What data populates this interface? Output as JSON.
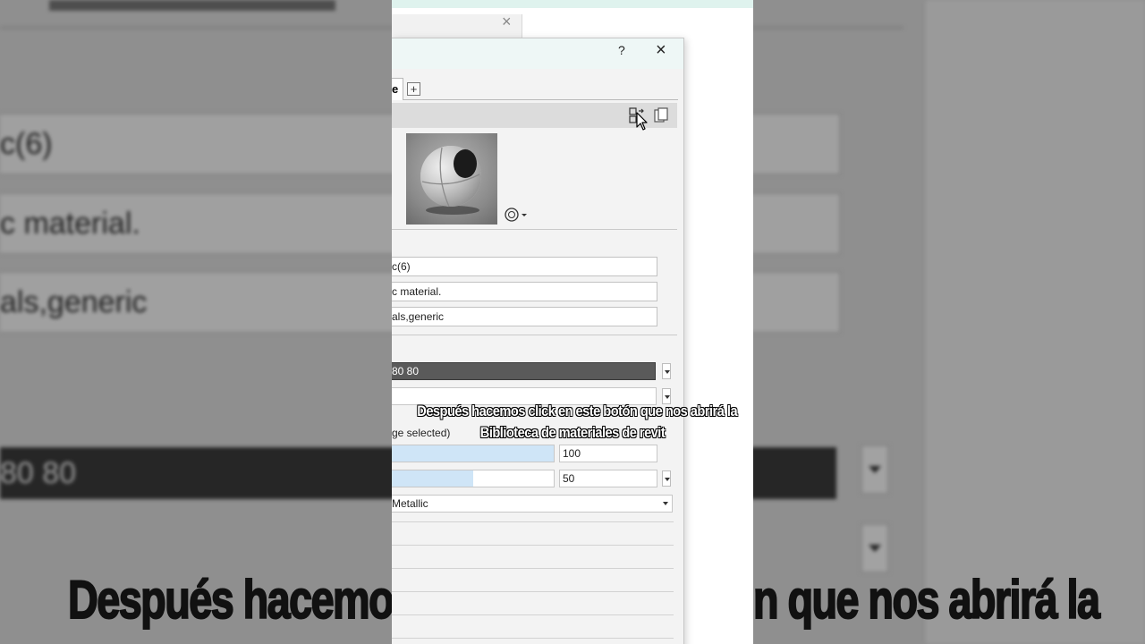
{
  "background_copy": {
    "fields": [
      "c(6)",
      "c material.",
      "als,generic"
    ],
    "color_text": "80 80",
    "caption_left": "Después hacemos",
    "caption_right": "n que nos abrirá la"
  },
  "dialog": {
    "help_label": "?",
    "close_label": "×",
    "back_window_close_label": "×",
    "tabs": [
      {
        "label": "e",
        "active": true
      }
    ],
    "add_tab_label": "+",
    "identity": {
      "name_value": "c(6)",
      "description_value": "c material.",
      "keywords_value": "als,generic"
    },
    "appearance": {
      "color_value": "80 80",
      "image_label": "ge selected)",
      "image_fade_value": "100",
      "image_fade_fill": 1.0,
      "glossiness_value": "50",
      "glossiness_fill": 0.5,
      "highlights_value": "Metallic"
    }
  },
  "caption": {
    "line1": "Después hacemos click en este botón que nos abrirá la",
    "line2": "Biblioteca de materiales de revit"
  },
  "icons": {
    "browser": "open-asset-browser-icon",
    "duplicate": "duplicate-asset-icon",
    "cursor": "mouse-cursor-icon",
    "preview_options": "render-preview-options-icon"
  },
  "colors": {
    "title_bar": "#eef7f6",
    "slider_fill": "#cfe5f7",
    "color_swatch": "#5a5a5a"
  }
}
